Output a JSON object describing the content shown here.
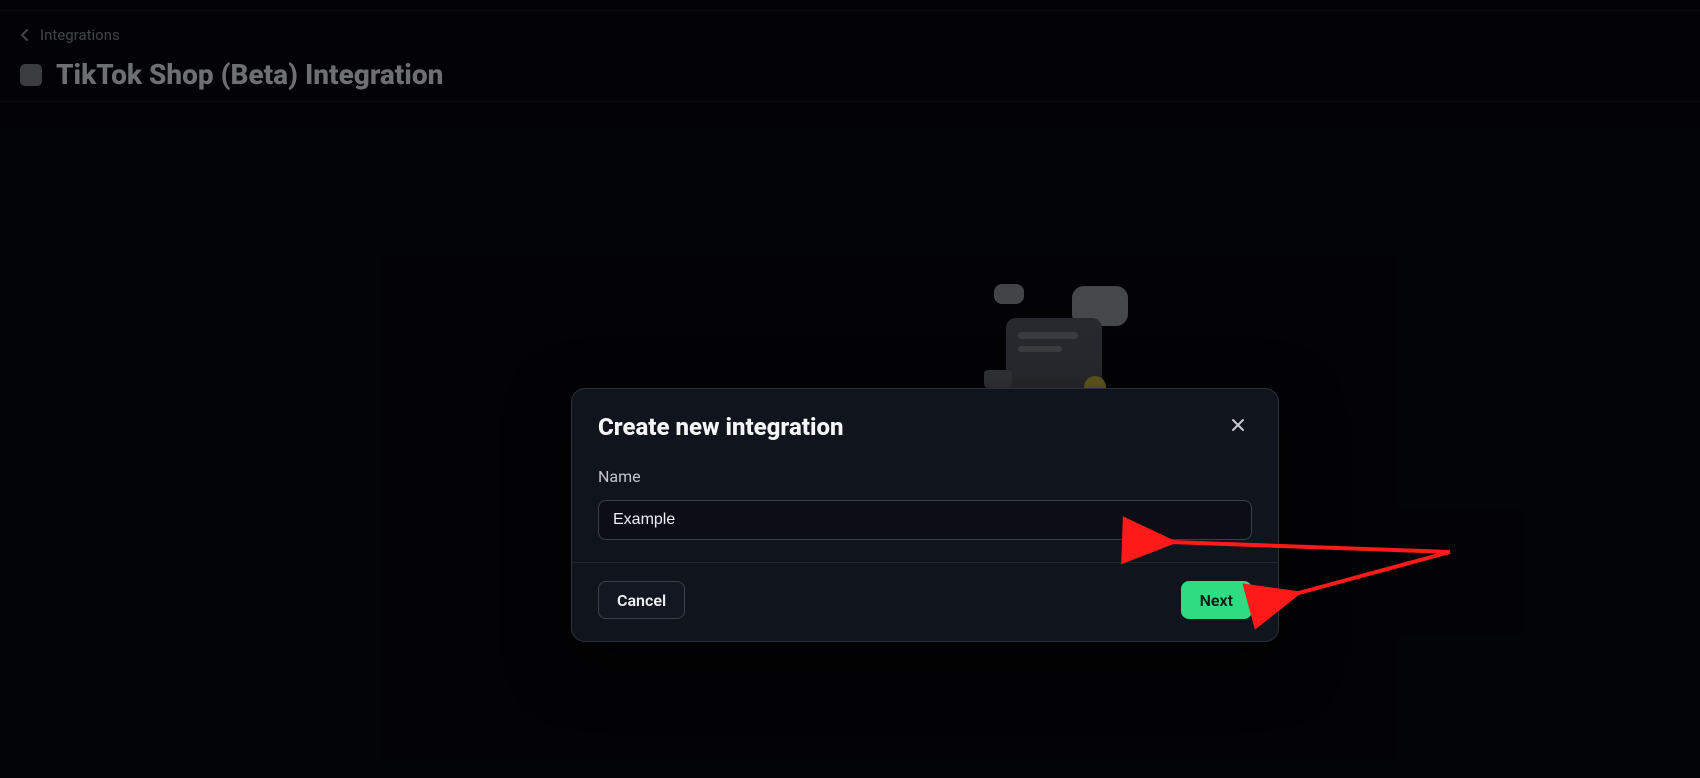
{
  "breadcrumb": {
    "parent": "Integrations"
  },
  "page": {
    "title": "TikTok Shop (Beta) Integration"
  },
  "modal": {
    "title": "Create new integration",
    "name_label": "Name",
    "name_value": "Example",
    "cancel_label": "Cancel",
    "next_label": "Next"
  },
  "colors": {
    "primary": "#2edc82",
    "surface": "#10141c",
    "border": "#2a2f3a"
  }
}
